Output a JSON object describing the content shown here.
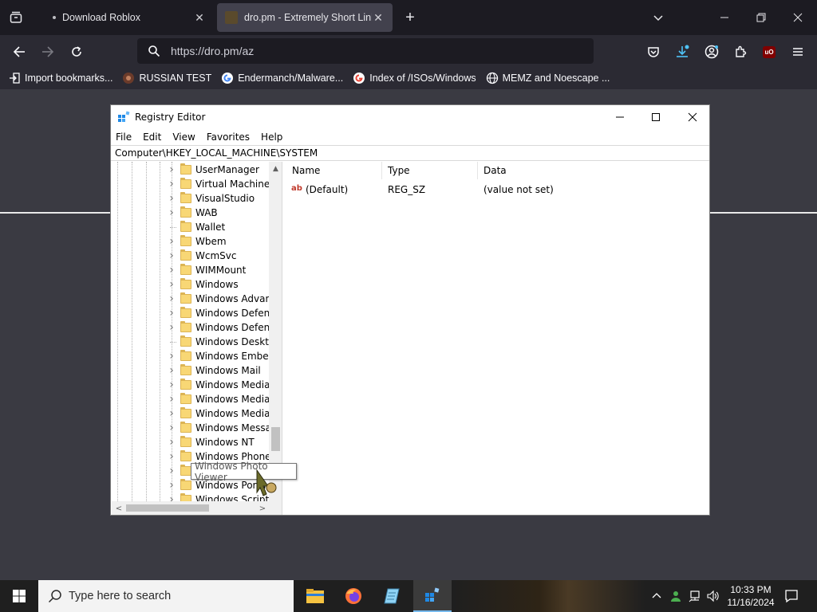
{
  "browser": {
    "tabs": [
      {
        "label": "Download Roblox",
        "active": false
      },
      {
        "label": "dro.pm - Extremely Short Links",
        "active": true
      }
    ],
    "url": "https://dro.pm/az",
    "bookmarks": [
      {
        "label": "Import bookmarks...",
        "icon": "import-icon"
      },
      {
        "label": "RUSSIAN TEST",
        "icon": "site-icon"
      },
      {
        "label": "Endermanch/Malware...",
        "icon": "google-icon"
      },
      {
        "label": "Index of /ISOs/Windows",
        "icon": "google-icon"
      },
      {
        "label": "MEMZ and Noescape ...",
        "icon": "globe-icon"
      }
    ],
    "ublock_label": "uO"
  },
  "regedit": {
    "title": "Registry Editor",
    "menu": [
      "File",
      "Edit",
      "View",
      "Favorites",
      "Help"
    ],
    "address": "Computer\\HKEY_LOCAL_MACHINE\\SYSTEM",
    "tree_items": [
      {
        "name": "UserManager",
        "expandable": true
      },
      {
        "name": "Virtual Machine",
        "expandable": true
      },
      {
        "name": "VisualStudio",
        "expandable": true
      },
      {
        "name": "WAB",
        "expandable": true
      },
      {
        "name": "Wallet",
        "expandable": false
      },
      {
        "name": "Wbem",
        "expandable": true
      },
      {
        "name": "WcmSvc",
        "expandable": true
      },
      {
        "name": "WIMMount",
        "expandable": true
      },
      {
        "name": "Windows",
        "expandable": true
      },
      {
        "name": "Windows Advanc",
        "expandable": true
      },
      {
        "name": "Windows Defend",
        "expandable": true
      },
      {
        "name": "Windows Defend",
        "expandable": true
      },
      {
        "name": "Windows Desktop",
        "expandable": false
      },
      {
        "name": "Windows Embedd",
        "expandable": true
      },
      {
        "name": "Windows Mail",
        "expandable": true
      },
      {
        "name": "Windows Media D",
        "expandable": true
      },
      {
        "name": "Windows Media F",
        "expandable": true
      },
      {
        "name": "Windows Media F",
        "expandable": true
      },
      {
        "name": "Windows Messag",
        "expandable": true
      },
      {
        "name": "Windows NT",
        "expandable": true
      },
      {
        "name": "Windows Phone",
        "expandable": true
      },
      {
        "name": "Windows Photo Viewer",
        "expandable": true
      },
      {
        "name": "Windows Porta",
        "expandable": true
      },
      {
        "name": "Windows Script H",
        "expandable": true
      }
    ],
    "columns": [
      "Name",
      "Type",
      "Data"
    ],
    "values": [
      {
        "name": "(Default)",
        "type": "REG_SZ",
        "data": "(value not set)"
      }
    ],
    "tooltip": "Windows Photo Viewer"
  },
  "taskbar": {
    "search_placeholder": "Type here to search",
    "apps": [
      "file-explorer-icon",
      "firefox-icon",
      "notepad-icon",
      "regedit-icon"
    ],
    "time": "10:33 PM",
    "date": "11/16/2024"
  },
  "colors": {
    "browser_dark": "#1c1b22",
    "toolbar": "#2b2a33",
    "folder": "#f8d775",
    "accent": "#76b9ed"
  }
}
